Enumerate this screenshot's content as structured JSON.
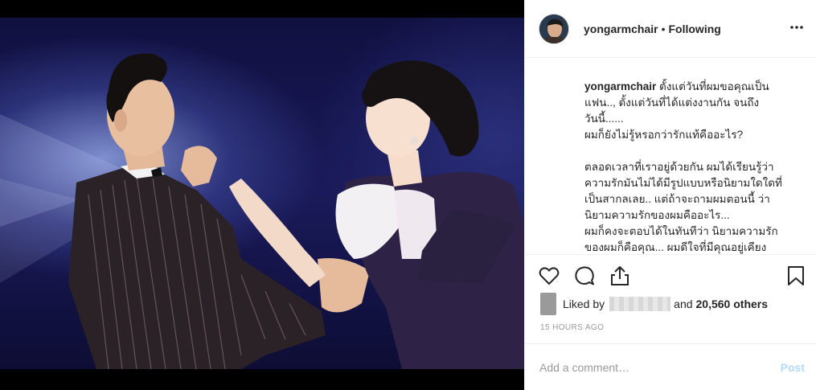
{
  "post": {
    "username": "yongarmchair",
    "separator": "•",
    "follow_status": "Following",
    "avatar_icon": "profile-avatar"
  },
  "caption": {
    "username": "yongarmchair",
    "line1": "ตั้งแต่วันที่ผมขอคุณเป็น",
    "line2": "แฟน.., ตั้งแต่วันที่ได้แต่งงานกัน จนถึง",
    "line3": "วันนี้......",
    "line4": "ผมก็ยังไม่รู้หรอกว่ารักแท้คืออะไร?",
    "line5": "ตลอดเวลาที่เราอยู่ด้วยกัน ผมได้เรียนรู้ว่า",
    "line6": "ความรักมันไม่ได้มีรูปแบบหรือนิยามใดใดที่",
    "line7": "เป็นสากลเลย.. แต่ถ้าจะถามผมตอนนี้ ว่า",
    "line8": "นิยามความรักของผมคืออะไร...",
    "line9": "ผมก็คงจะตอบได้ในทันทีว่า นิยามความรัก",
    "line10": "ของผมก็คือคุณ... ผมดีใจที่มีคุณอยู่เคียง"
  },
  "actions": {
    "like_icon": "heart-icon",
    "comment_icon": "comment-icon",
    "share_icon": "share-icon",
    "save_icon": "bookmark-icon"
  },
  "likes": {
    "prefix": "Liked by",
    "middle": "and",
    "count": "20,560 others"
  },
  "timestamp": "15 HOURS AGO",
  "comment": {
    "placeholder": "Add a comment…",
    "post_label": "Post"
  },
  "colors": {
    "post_disabled": "#b3dbff",
    "meta_gray": "#999999",
    "text": "#262626"
  }
}
